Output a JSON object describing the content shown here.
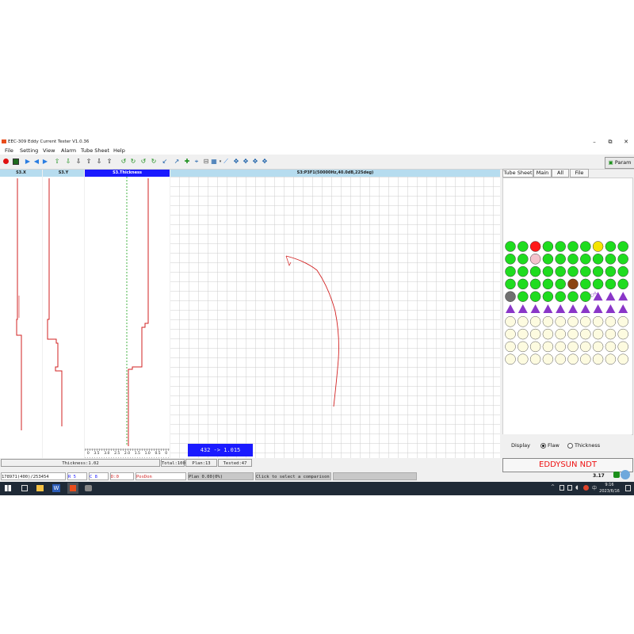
{
  "window": {
    "title": "EEC-309 Eddy Current Tester   V1.0.36",
    "minimize": "–",
    "restore": "⧉",
    "close": "✕"
  },
  "menu": [
    "File",
    "Setting",
    "View",
    "Alarm",
    "Tube Sheet",
    "Help"
  ],
  "toolbar": {
    "icons": [
      "record-icon",
      "stop-icon",
      "play-icon",
      "back-icon",
      "forward-icon",
      "up-green-icon",
      "down-icon",
      "up-icon",
      "down2-icon",
      "up2-icon",
      "rotate-left-icon",
      "rotate-right-icon",
      "rotate-left2-icon",
      "rotate-right2-icon",
      "shrink-icon",
      "cross-icon",
      "crosshair-icon",
      "ruler-icon",
      "grid-icon",
      "dropdown-icon",
      "chart-icon",
      "move-horizontal-icon",
      "move-vertical-icon",
      "move-up-icon",
      "move-all-icon"
    ],
    "param_label": "Param"
  },
  "channels": {
    "x_label": "S3.X",
    "y_label": "S3.Y",
    "thickness_label": "S3.Thickness",
    "lissajous_label": "S3:P3F1(50000Hz,40.0dB,225deg)",
    "ruler_ticks": [
      "0",
      "3.5",
      "3.0",
      "2.5",
      "2.0",
      "1.5",
      "1.0",
      "0.5",
      "0"
    ],
    "readout": "432 -> 1.015"
  },
  "tabs": [
    "Tube Sheet",
    "Main",
    "All",
    "File"
  ],
  "tubesheet": {
    "rows": [
      [
        "green",
        "green",
        "red",
        "green",
        "green",
        "green",
        "green",
        "yellow",
        "green",
        "green"
      ],
      [
        "green",
        "green",
        "pink",
        "green",
        "green",
        "green",
        "green",
        "green",
        "green",
        "green"
      ],
      [
        "green",
        "green",
        "green",
        "green",
        "green",
        "green",
        "green",
        "green",
        "green",
        "green"
      ],
      [
        "green",
        "green",
        "green",
        "green",
        "green",
        "brown",
        "green",
        "green",
        "green",
        "green"
      ],
      [
        "gray",
        "green",
        "green",
        "green",
        "green",
        "green",
        "green",
        "tri",
        "tri",
        "tri"
      ],
      [
        "tri",
        "tri",
        "tri",
        "tri",
        "tri",
        "tri",
        "tri",
        "tri",
        "tri",
        "tri"
      ],
      [
        "cream",
        "cream",
        "cream",
        "cream",
        "cream",
        "cream",
        "cream",
        "cream",
        "cream",
        "cream"
      ],
      [
        "cream",
        "cream",
        "cream",
        "cream",
        "cream",
        "cream",
        "cream",
        "cream",
        "cream",
        "cream"
      ],
      [
        "cream",
        "cream",
        "cream",
        "cream",
        "cream",
        "cream",
        "cream",
        "cream",
        "cream",
        "cream"
      ],
      [
        "cream",
        "cream",
        "cream",
        "cream",
        "cream",
        "cream",
        "cream",
        "cream",
        "cream",
        "cream"
      ]
    ],
    "marker_label": "Cnt"
  },
  "display": {
    "label": "Display",
    "option_flaw": "Flaw",
    "option_thickness": "Thickness"
  },
  "brand": "EDDYSUN NDT",
  "status_row1": {
    "thickness": "Thickness:1.02",
    "total": "Total:100",
    "plan": "Plan:13",
    "tested": "Tested:47"
  },
  "status_row2": {
    "pos": "178971(400)/253454",
    "r": "R 5",
    "c": "C 8",
    "d": "D:0",
    "posdon": "PosDon",
    "plan": "Plan 0.00(0%)",
    "hint": "Click to select a comparison"
  },
  "taskbar": {
    "time": "9:16",
    "date": "2023/6/16",
    "version": "3.17"
  },
  "colors": {
    "trace": "#d22222",
    "header_active": "#1a1aff",
    "grid": "#b8b8b8",
    "green": "#1fdc1f",
    "red": "#ff1a1a",
    "yellow": "#f5e400",
    "pink": "#f4c2cc",
    "brown": "#8b4513",
    "gray": "#707070",
    "purple": "#8a36c8",
    "cream": "#fdfbe0"
  }
}
